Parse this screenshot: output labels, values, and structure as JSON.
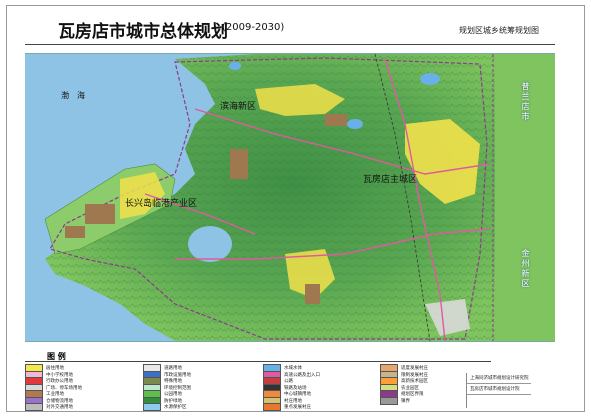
{
  "header": {
    "title": "瓦房店市城市总体规划",
    "years": "(2009-2030)",
    "subtitle": "规划区城乡统筹规划图"
  },
  "map": {
    "labels": {
      "sea": "渤　海",
      "binhai": "滨海新区",
      "main_city": "瓦房店主城区",
      "changxing": "长兴岛临港产业区",
      "pulandian": "普兰店市",
      "jinzhou": "金州新区"
    },
    "colors": {
      "sea": "#8fc3e6",
      "land_low": "#7fc45e",
      "land_high": "#3f8f46",
      "urban": "#f2e14a",
      "industry": "#a07850",
      "road": "#e05aa0",
      "boundary": "#8c3a8c"
    }
  },
  "legend": {
    "title": "图 例",
    "items": [
      {
        "label": "居住用地",
        "color": "#f5e84a"
      },
      {
        "label": "中小学校用地",
        "color": "#f0b8d8"
      },
      {
        "label": "行政办公用地",
        "color": "#e23a3a"
      },
      {
        "label": "广场、停车场用地",
        "color": "#d9d9d9"
      },
      {
        "label": "工业用地",
        "color": "#b07a50"
      },
      {
        "label": "仓储物流用地",
        "color": "#9a6fd0"
      },
      {
        "label": "对外交通用地",
        "color": "#bcbcbc"
      },
      {
        "label": "道路用地",
        "color": "#e8e8e8"
      },
      {
        "label": "市政设施用地",
        "color": "#3b6fc8"
      },
      {
        "label": "特殊用地",
        "color": "#7a8a4a"
      },
      {
        "label": "环境控制范围",
        "color": "#bde8d0"
      },
      {
        "label": "公园用地",
        "color": "#5fbf4a"
      },
      {
        "label": "防护绿地",
        "color": "#2f8f3f"
      },
      {
        "label": "水源保护区",
        "color": "#8ec9f0"
      },
      {
        "label": "水域水体",
        "color": "#6ab0e8"
      },
      {
        "label": "高速公路及出入口",
        "color": "#e05aa0"
      },
      {
        "label": "公路",
        "color": "#c04040"
      },
      {
        "label": "铁路及站场",
        "color": "#333333"
      },
      {
        "label": "中心城镇用地",
        "color": "#f08a3a"
      },
      {
        "label": "村庄用地",
        "color": "#d8c070"
      },
      {
        "label": "重点发展村庄",
        "color": "#e7762e"
      },
      {
        "label": "适度发展村庄",
        "color": "#e9a66a"
      },
      {
        "label": "限制发展村庄",
        "color": "#c5b490"
      },
      {
        "label": "高新技术园区",
        "color": "#ff9f3a"
      },
      {
        "label": "农业园区",
        "color": "#d6e07a"
      },
      {
        "label": "规划区界限",
        "color": "#8c3a8c"
      },
      {
        "label": "镇界",
        "color": "#999999"
      }
    ]
  },
  "footer": {
    "org1": "上海同济城市规划设计研究院",
    "org2": "瓦房店市城市规划设计院"
  }
}
